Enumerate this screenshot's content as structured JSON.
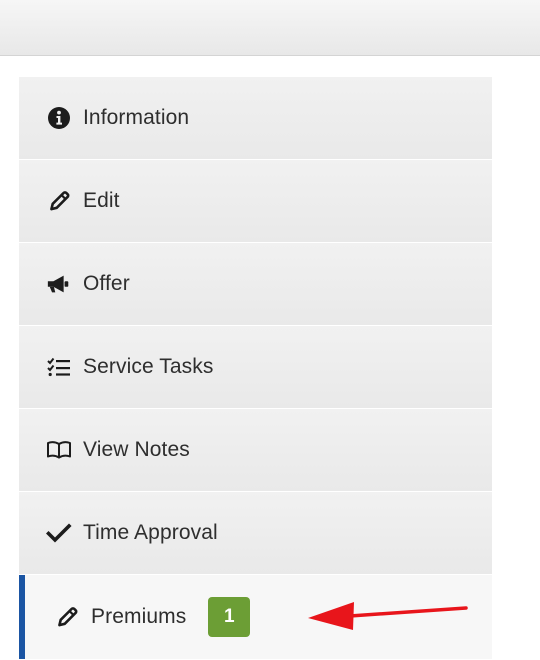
{
  "menu": {
    "items": [
      {
        "label": "Information",
        "icon": "info-circle-icon"
      },
      {
        "label": "Edit",
        "icon": "pencil-icon"
      },
      {
        "label": "Offer",
        "icon": "megaphone-icon"
      },
      {
        "label": "Service Tasks",
        "icon": "checklist-icon"
      },
      {
        "label": "View Notes",
        "icon": "open-book-icon"
      },
      {
        "label": "Time Approval",
        "icon": "check-icon"
      },
      {
        "label": "Premiums",
        "icon": "pencil-icon",
        "badge": "1",
        "active": true
      }
    ]
  },
  "colors": {
    "active_indicator": "#1b55a3",
    "badge": "#6c9e35",
    "annotation_arrow": "#e8151b"
  }
}
